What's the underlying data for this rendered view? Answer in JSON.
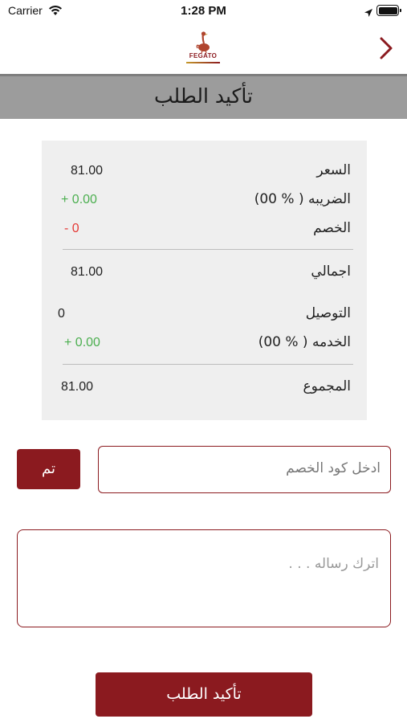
{
  "status_bar": {
    "carrier": "Carrier",
    "time": "1:28 PM"
  },
  "nav": {
    "logo_text": "FEGATO",
    "back_icon": "chevron-right-icon"
  },
  "header": {
    "title": "تأكيد الطلب"
  },
  "summary": {
    "price_label": "السعر",
    "price_value": "81.00",
    "tax_label": "الضريبه ( % 00)",
    "tax_value": "+ 0.00",
    "discount_label": "الخصم",
    "discount_value": "- 0",
    "total_label": "اجمالي",
    "total_value": "81.00",
    "delivery_label": "التوصيل",
    "delivery_value": "0",
    "service_label": "الخدمه ( % 00)",
    "service_value": "+ 0.00",
    "grand_total_label": "المجموع",
    "grand_total_value": "81.00"
  },
  "coupon": {
    "placeholder": "ادخل كود الخصم",
    "apply_label": "تم"
  },
  "message": {
    "placeholder": "اترك رساله . . ."
  },
  "confirm": {
    "label": "تأكيد الطلب"
  },
  "colors": {
    "brand": "#8b1a1f",
    "positive": "#4caf50",
    "negative": "#e53935",
    "title_bar": "#9c9c9c",
    "card_bg": "#efefef"
  }
}
